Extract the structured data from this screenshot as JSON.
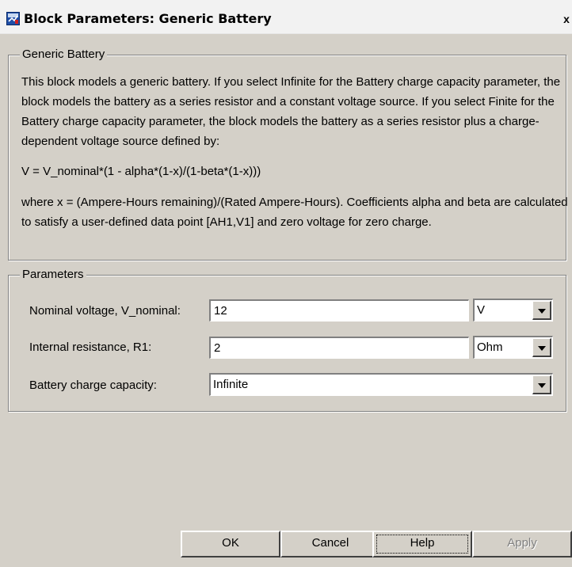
{
  "window": {
    "title": "Block Parameters: Generic Battery",
    "close_label": "x"
  },
  "description": {
    "group_title": "Generic Battery",
    "paragraph1": "This block models a generic battery. If you select Infinite for the Battery charge capacity parameter, the block models the battery as a series resistor and a constant voltage source. If you select Finite for the Battery charge capacity parameter, the block models the battery as a series resistor plus a charge-dependent voltage source defined by:",
    "formula": "V = V_nominal*(1 - alpha*(1-x)/(1-beta*(1-x)))",
    "paragraph2": "where x = (Ampere-Hours remaining)/(Rated Ampere-Hours). Coefficients alpha and beta are calculated to satisfy a user-defined data point [AH1,V1] and zero voltage for zero charge."
  },
  "parameters": {
    "group_title": "Parameters",
    "nominal_voltage": {
      "label": "Nominal voltage, V_nominal:",
      "value": "12",
      "unit": "V"
    },
    "internal_resistance": {
      "label": "Internal resistance, R1:",
      "value": "2",
      "unit": "Ohm"
    },
    "charge_capacity": {
      "label": "Battery charge capacity:",
      "value": "Infinite"
    }
  },
  "buttons": {
    "ok": "OK",
    "cancel": "Cancel",
    "help": "Help",
    "apply": "Apply"
  },
  "icons": {
    "app": "simulink-block-icon",
    "dropdown": "chevron-down-icon"
  }
}
